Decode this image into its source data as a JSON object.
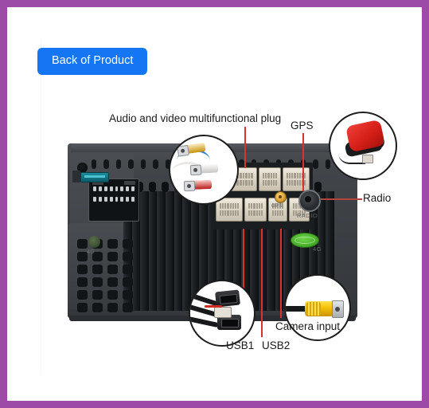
{
  "page": {
    "border_color": "#9c4ba6",
    "background": "#ffffff"
  },
  "header": {
    "button_label": "Back of Product",
    "button_color": "#1476f2"
  },
  "product": {
    "name": "car-stereo-head-unit-rear",
    "chassis_color": "#3a3e43",
    "embossed": {
      "gps": "GPS",
      "radio": "RADIO",
      "lte": "4G",
      "lte_left": "4G"
    }
  },
  "callouts": [
    {
      "id": "av-plug",
      "label": "Audio and video multifunctional plug",
      "bubble": "rca-av-cable",
      "leader_color": "#d8332c"
    },
    {
      "id": "gps",
      "label": "GPS",
      "bubble": "gps-antenna-puck",
      "leader_color": "#d8332c"
    },
    {
      "id": "radio",
      "label": "Radio",
      "bubble": null,
      "leader_color": "#b4443c"
    },
    {
      "id": "usb1",
      "label": "USB1",
      "bubble": "usb-cable-harness",
      "leader_color": "#d8332c"
    },
    {
      "id": "usb2",
      "label": "USB2",
      "bubble": null,
      "leader_color": "#d8332c"
    },
    {
      "id": "camera-input",
      "label": "Camera input",
      "bubble": "yellow-rca-plug",
      "leader_color": "#d8332c"
    }
  ],
  "labels": {
    "av": "Audio and video multifunctional plug",
    "gps": "GPS",
    "radio": "Radio",
    "usb1": "USB1",
    "usb2": "USB2",
    "camera": "Camera input"
  }
}
